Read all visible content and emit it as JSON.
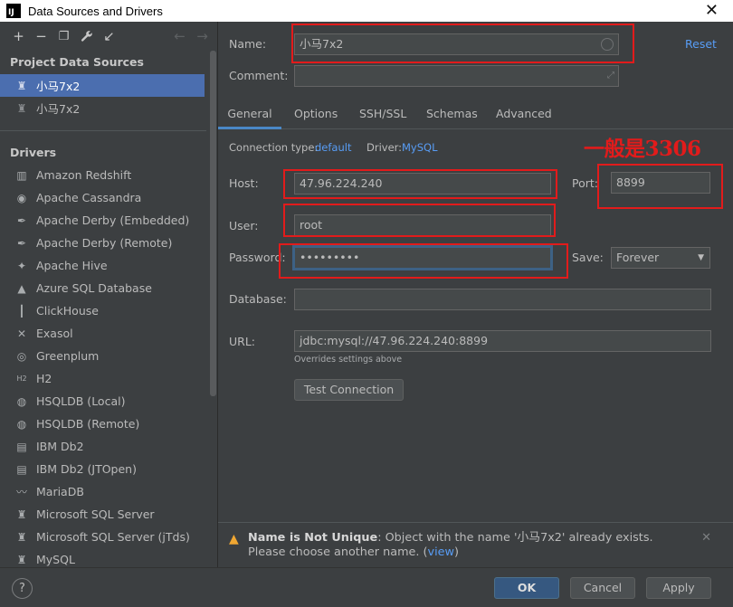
{
  "window": {
    "title": "Data Sources and Drivers",
    "app_icon_text": "IJ"
  },
  "toolbar": {
    "add": "+",
    "remove": "−",
    "duplicate": "❐",
    "settings": "🔧",
    "import": "↙",
    "back": "←",
    "forward": "→"
  },
  "project_sources": {
    "title": "Project Data Sources",
    "items": [
      {
        "label": "小马7x2",
        "selected": true
      },
      {
        "label": "小马7x2",
        "selected": false
      }
    ]
  },
  "drivers": {
    "title": "Drivers",
    "items": [
      {
        "label": "Amazon Redshift",
        "icon": "▥"
      },
      {
        "label": "Apache Cassandra",
        "icon": "◉"
      },
      {
        "label": "Apache Derby (Embedded)",
        "icon": "✒"
      },
      {
        "label": "Apache Derby (Remote)",
        "icon": "✒"
      },
      {
        "label": "Apache Hive",
        "icon": "✦"
      },
      {
        "label": "Azure SQL Database",
        "icon": "▲"
      },
      {
        "label": "ClickHouse",
        "icon": "┃"
      },
      {
        "label": "Exasol",
        "icon": "✕"
      },
      {
        "label": "Greenplum",
        "icon": "◎"
      },
      {
        "label": "H2",
        "icon": "H2"
      },
      {
        "label": "HSQLDB (Local)",
        "icon": "◍"
      },
      {
        "label": "HSQLDB (Remote)",
        "icon": "◍"
      },
      {
        "label": "IBM Db2",
        "icon": "▤"
      },
      {
        "label": "IBM Db2 (JTOpen)",
        "icon": "▤"
      },
      {
        "label": "MariaDB",
        "icon": "〰"
      },
      {
        "label": "Microsoft SQL Server",
        "icon": "♜"
      },
      {
        "label": "Microsoft SQL Server (jTds)",
        "icon": "♜"
      },
      {
        "label": "MySQL",
        "icon": "♜"
      }
    ]
  },
  "form": {
    "name_label": "Name:",
    "name_value": "小马7x2",
    "reset_label": "Reset",
    "comment_label": "Comment:",
    "comment_value": "",
    "tabs": [
      "General",
      "Options",
      "SSH/SSL",
      "Schemas",
      "Advanced"
    ],
    "active_tab": "General",
    "connection_type_label": "Connection type:",
    "connection_type_value": "default",
    "driver_label": "Driver:",
    "driver_value": "MySQL",
    "host_label": "Host:",
    "host_value": "47.96.224.240",
    "port_label": "Port:",
    "port_value": "8899",
    "user_label": "User:",
    "user_value": "root",
    "password_label": "Password:",
    "password_value": "•••••••••",
    "save_label": "Save:",
    "save_value": "Forever",
    "database_label": "Database:",
    "database_value": "",
    "url_label": "URL:",
    "url_value": "jdbc:mysql://47.96.224.240:8899",
    "url_hint": "Overrides settings above",
    "test_connection_label": "Test Connection"
  },
  "annotation": {
    "text": "一般是3306",
    "color": "#e21b1b"
  },
  "warning": {
    "title": "Name is Not Unique",
    "message": ": Object with the name '小马7x2' already exists. Please choose another name. (",
    "link": "view",
    "tail": ")"
  },
  "buttons": {
    "help": "?",
    "ok": "OK",
    "cancel": "Cancel",
    "apply": "Apply"
  },
  "colors": {
    "accent": "#4b6eaf",
    "link": "#589df6",
    "warning": "#f0a732",
    "highlight": "#e21b1b"
  }
}
